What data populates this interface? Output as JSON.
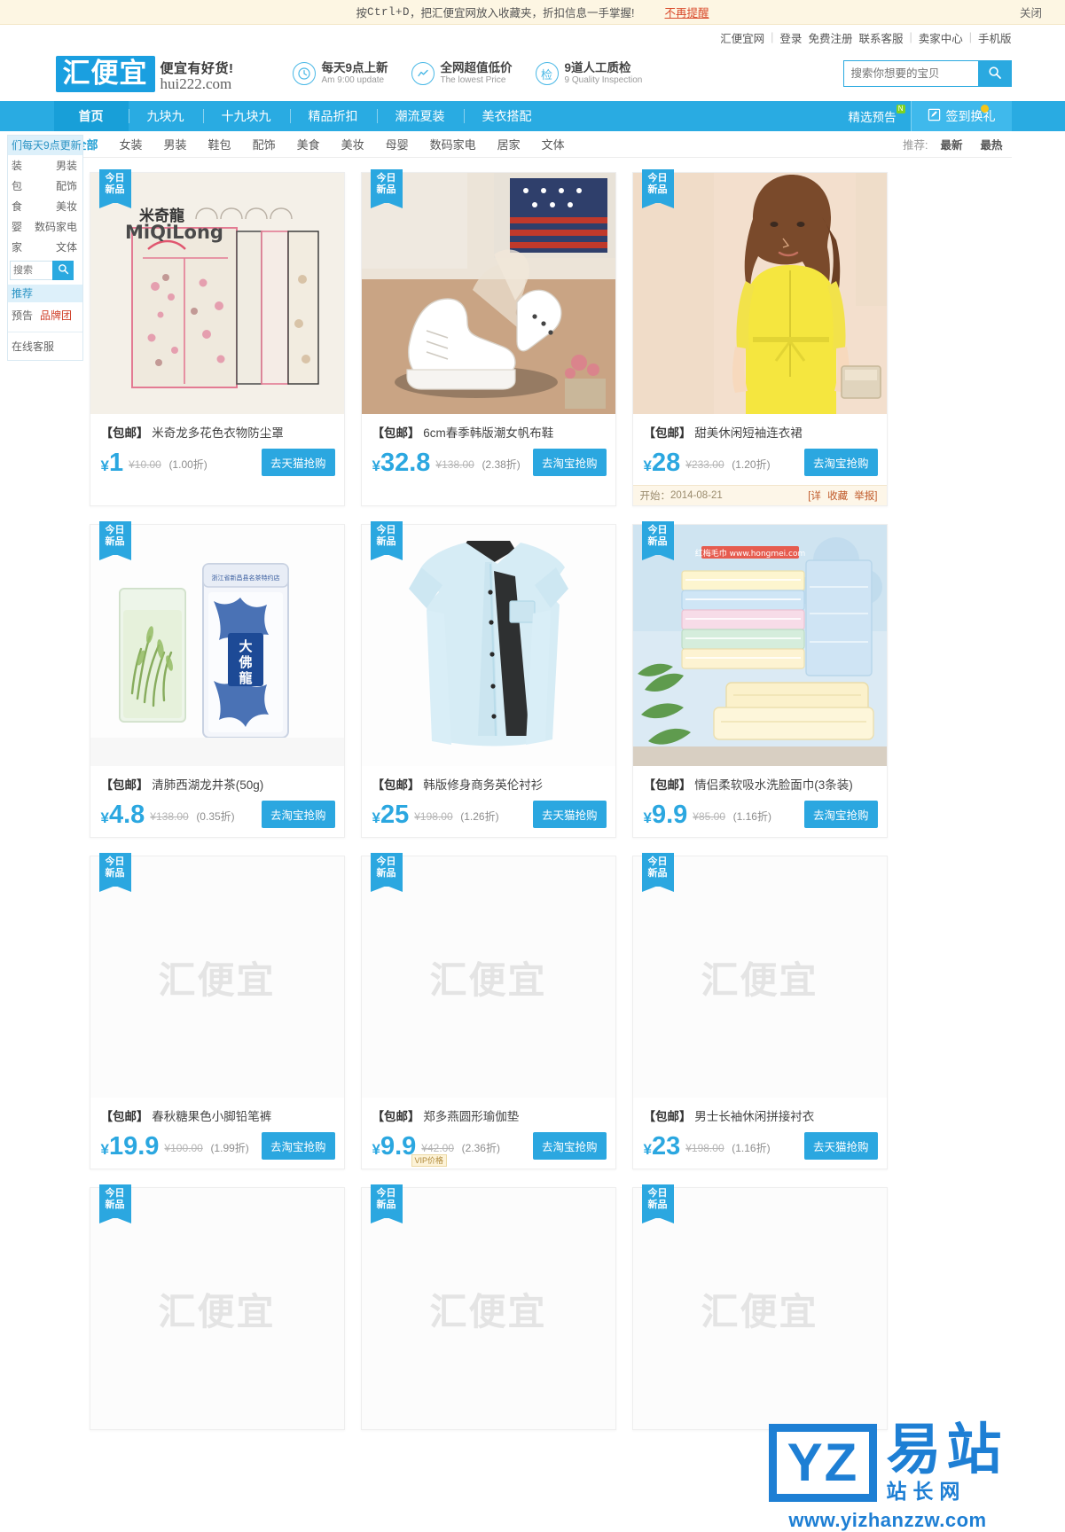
{
  "tipbar": {
    "text_prefix": "按 ",
    "shortcut": "Ctrl+D",
    "text_suffix": "，把汇便宜网放入收藏夹，折扣信息一手掌握!",
    "no_remind": "不再提醒",
    "close": "关闭"
  },
  "topnav": {
    "site": "汇便宜网",
    "login": "登录",
    "register": "免费注册",
    "service": "联系客服",
    "seller": "卖家中心",
    "mobile": "手机版"
  },
  "logo": {
    "mark": "汇便宜",
    "slogan": "便宜有好货!",
    "domain": "hui222.com"
  },
  "features": [
    {
      "icon": "clock-icon",
      "title": "每天9点上新",
      "sub": "Am 9:00 update"
    },
    {
      "icon": "chart-icon",
      "title": "全网超值低价",
      "sub": "The lowest Price"
    },
    {
      "icon": "inspect-icon",
      "title": "9道人工质检",
      "sub": "9 Quality Inspection"
    }
  ],
  "search": {
    "placeholder": "搜索你想要的宝贝",
    "icon": "search-icon"
  },
  "mainnav": {
    "items": [
      {
        "label": "首页",
        "active": true
      },
      {
        "label": "九块九",
        "active": false
      },
      {
        "label": "十九块九",
        "active": false
      },
      {
        "label": "精品折扣",
        "active": false
      },
      {
        "label": "潮流夏装",
        "active": false
      },
      {
        "label": "美衣搭配",
        "active": false
      }
    ],
    "preview": {
      "label": "精选预告",
      "badge": "N"
    },
    "signin": {
      "label": "签到换礼",
      "icon": "pencil-icon"
    }
  },
  "categories": [
    {
      "label": "全部",
      "active": true
    },
    {
      "label": "女装",
      "active": false
    },
    {
      "label": "男装",
      "active": false
    },
    {
      "label": "鞋包",
      "active": false
    },
    {
      "label": "配饰",
      "active": false
    },
    {
      "label": "美食",
      "active": false
    },
    {
      "label": "美妆",
      "active": false
    },
    {
      "label": "母婴",
      "active": false
    },
    {
      "label": "数码家电",
      "active": false
    },
    {
      "label": "居家",
      "active": false
    },
    {
      "label": "文体",
      "active": false
    }
  ],
  "sorts": {
    "label": "推荐:",
    "items": [
      "最新",
      "最热"
    ]
  },
  "sidebar": {
    "title": "们每天9点更新",
    "rows": [
      {
        "left": "装",
        "right": "男装"
      },
      {
        "left": "包",
        "right": "配饰"
      },
      {
        "left": "食",
        "right": "美妆"
      },
      {
        "left": "婴",
        "right": "数码家电"
      },
      {
        "left": "家",
        "right": "文体"
      }
    ],
    "search_placeholder": "搜索",
    "search_icon": "search-icon",
    "section": "推荐",
    "links": [
      {
        "label": "预告",
        "red": false
      },
      {
        "label": "品牌团",
        "red": true
      }
    ],
    "service": "在线客服"
  },
  "ribbon": {
    "line1": "今日",
    "line2": "新品"
  },
  "watermark": "汇便宜",
  "products": [
    {
      "ribbon": true,
      "image": "clothes-dust-cover-photo",
      "placeholder": false,
      "tag": "【包邮】",
      "name": "米奇龙多花色衣物防尘罩",
      "price": "1",
      "old_price": "¥10.00",
      "discount": "(1.00折)",
      "buy_label": "去天猫抢购",
      "vip": null,
      "info": null
    },
    {
      "ribbon": true,
      "image": "white-canvas-shoes-photo",
      "placeholder": false,
      "tag": "【包邮】",
      "name": "6cm春季韩版潮女帆布鞋",
      "price": "32.8",
      "old_price": "¥138.00",
      "discount": "(2.38折)",
      "buy_label": "去淘宝抢购",
      "vip": null,
      "info": null
    },
    {
      "ribbon": true,
      "image": "yellow-dress-model-photo",
      "placeholder": false,
      "tag": "【包邮】",
      "name": "甜美休闲短袖连衣裙",
      "price": "28",
      "old_price": "¥233.00",
      "discount": "(1.20折)",
      "buy_label": "去淘宝抢购",
      "vip": null,
      "info": {
        "start_label": "开始：",
        "start_date": "2014-08-21",
        "detail": "[详",
        "fav": "收藏",
        "report": "举报]"
      }
    },
    {
      "ribbon": true,
      "image": "longjing-tea-photo",
      "placeholder": false,
      "tag": "【包邮】",
      "name": "清肺西湖龙井茶(50g)",
      "price": "4.8",
      "old_price": "¥138.00",
      "discount": "(0.35折)",
      "buy_label": "去淘宝抢购",
      "vip": null,
      "info": null
    },
    {
      "ribbon": true,
      "image": "light-blue-shirt-photo",
      "placeholder": false,
      "tag": "【包邮】",
      "name": "韩版修身商务英伦衬衫",
      "price": "25",
      "old_price": "¥198.00",
      "discount": "(1.26折)",
      "buy_label": "去天猫抢购",
      "vip": null,
      "info": null
    },
    {
      "ribbon": true,
      "image": "stacked-towels-photo",
      "placeholder": false,
      "tag": "【包邮】",
      "name": "情侣柔软吸水洗脸面巾(3条装)",
      "price": "9.9",
      "old_price": "¥85.00",
      "discount": "(1.16折)",
      "buy_label": "去淘宝抢购",
      "vip": null,
      "info": null
    },
    {
      "ribbon": true,
      "image": "placeholder",
      "placeholder": true,
      "tag": "【包邮】",
      "name": "春秋糖果色小脚铅笔裤",
      "price": "19.9",
      "old_price": "¥100.00",
      "discount": "(1.99折)",
      "buy_label": "去淘宝抢购",
      "vip": null,
      "info": null
    },
    {
      "ribbon": true,
      "image": "placeholder",
      "placeholder": true,
      "tag": "【包邮】",
      "name": "郑多燕圆形瑜伽垫",
      "price": "9.9",
      "old_price": "¥42.00",
      "discount": "(2.36折)",
      "buy_label": "去淘宝抢购",
      "vip": "VIP价格",
      "info": null
    },
    {
      "ribbon": true,
      "image": "placeholder",
      "placeholder": true,
      "tag": "【包邮】",
      "name": "男士长袖休闲拼接衬衣",
      "price": "23",
      "old_price": "¥198.00",
      "discount": "(1.16折)",
      "buy_label": "去天猫抢购",
      "vip": null,
      "info": null
    },
    {
      "ribbon": true,
      "image": "placeholder",
      "placeholder": true,
      "tag": "",
      "name": "",
      "price": "",
      "old_price": "",
      "discount": "",
      "buy_label": "",
      "vip": null,
      "info": null
    },
    {
      "ribbon": true,
      "image": "placeholder",
      "placeholder": true,
      "tag": "",
      "name": "",
      "price": "",
      "old_price": "",
      "discount": "",
      "buy_label": "",
      "vip": null,
      "info": null
    },
    {
      "ribbon": true,
      "image": "placeholder",
      "placeholder": true,
      "tag": "",
      "name": "",
      "price": "",
      "old_price": "",
      "discount": "",
      "buy_label": "",
      "vip": null,
      "info": null
    }
  ],
  "overlay_watermark": {
    "left_letters": "YZ",
    "cn_big": "易站",
    "cn_small": "站长网",
    "url": "www.yizhanzzw.com",
    "color": "#1e7fd4"
  }
}
